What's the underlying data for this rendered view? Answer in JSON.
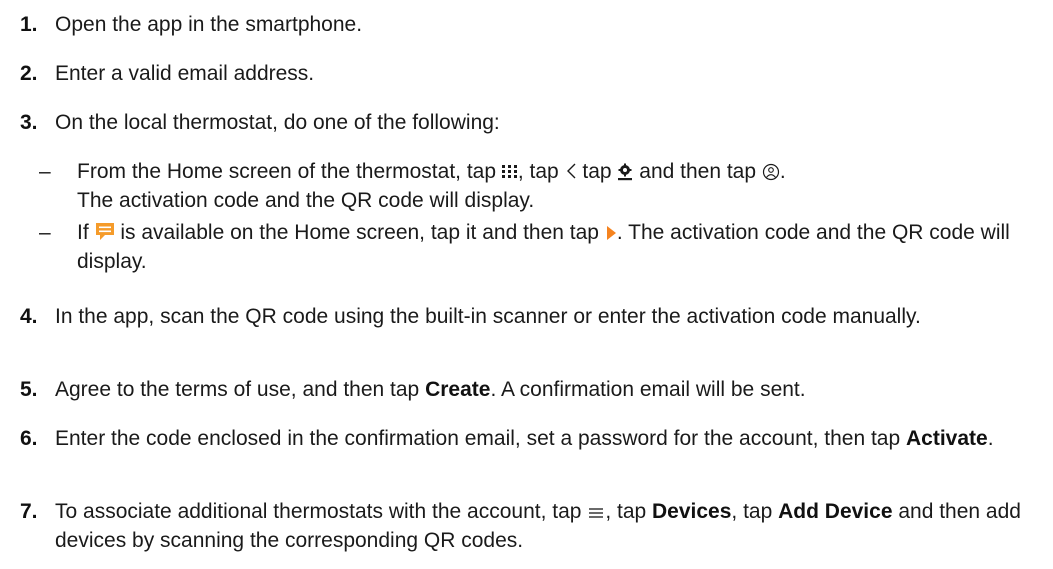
{
  "icons": {
    "menu_grid": "grid-menu-icon",
    "back": "chevron-left-icon",
    "settings": "settings-gear-icon",
    "account": "account-circle-icon",
    "message": "message-bubble-icon",
    "play": "play-triangle-icon",
    "hamburger": "hamburger-menu-icon"
  },
  "colors": {
    "message_icon": "#f59b2a",
    "play_icon": "#f5831f",
    "text": "#1a1a1a"
  },
  "steps": [
    {
      "num": "1.",
      "text": "Open the app in the smartphone."
    },
    {
      "num": "2.",
      "text": "Enter a valid email address."
    },
    {
      "num": "3.",
      "text": "On the local thermostat, do one of the following:"
    },
    {
      "num": "4.",
      "text": "In the app, scan the QR code using the built-in scanner or enter the activation code manually."
    },
    {
      "num": "5.",
      "p1": "Agree to the terms of use, and then tap ",
      "b1": "Create",
      "p2": ". A confirmation email will be sent."
    },
    {
      "num": "6.",
      "p1": "Enter the code enclosed in the confirmation email, set a password for the account, then tap ",
      "b1": "Activate",
      "p2": "."
    },
    {
      "num": "7.",
      "p1": "To associate additional thermostats with the account, tap ",
      "p2": ", tap ",
      "b1": "Devices",
      "p3": ", tap ",
      "b2": "Add Device",
      "p4": " and then add devices by scanning the corresponding QR codes."
    }
  ],
  "substeps": [
    {
      "dash": "–",
      "p1": "From the Home screen of the thermostat, tap ",
      "p2": ", tap ",
      "p3": " tap ",
      "p4": " and then tap ",
      "p5": ".",
      "p6": "The activation code and the QR code will display."
    },
    {
      "dash": "–",
      "p1": "If ",
      "p2": " is available on the Home screen, tap it and then tap ",
      "p3": ". The activation code and the QR code will display."
    }
  ]
}
